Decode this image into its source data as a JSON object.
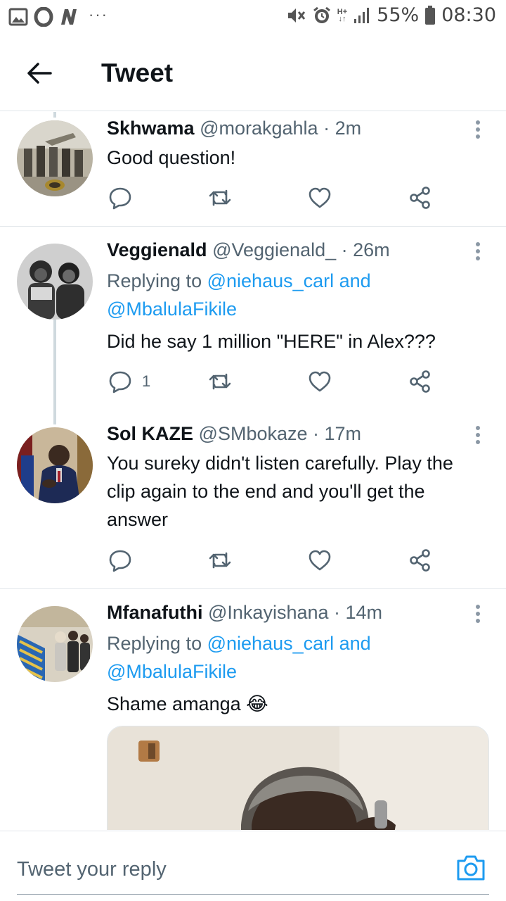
{
  "status_bar": {
    "battery": "55%",
    "time": "08:30",
    "network": "H+",
    "dots": "···",
    "icons": [
      "gallery-icon",
      "opera-icon",
      "news-icon",
      "mute-icon",
      "alarm-icon",
      "signal-icon",
      "battery-icon"
    ]
  },
  "header": {
    "title": "Tweet",
    "back_icon": "arrow-left-icon"
  },
  "tweets": [
    {
      "name": "Skhwama",
      "handle": "@morakgahla",
      "time": "· 2m",
      "text": "Good question!",
      "reply_count": "",
      "retweet_count": "",
      "like_count": ""
    },
    {
      "name": "Veggienald",
      "handle": "@Veggienald_",
      "time": "· 26m",
      "replying_prefix": "Replying to",
      "mention_1": "@niehaus_carl",
      "and": "and",
      "mention_2": "@MbalulaFikile",
      "text": "Did he say 1 million \"HERE\" in Alex???",
      "reply_count": "1",
      "retweet_count": "",
      "like_count": ""
    },
    {
      "name": "Sol KAZE",
      "handle": "@SMbokaze",
      "time": "· 17m",
      "text": "You sureky didn't listen carefully.  Play the clip again to the end and you'll get the answer",
      "reply_count": "",
      "retweet_count": "",
      "like_count": ""
    },
    {
      "name": "Mfanafuthi",
      "handle": "@Inkayishana",
      "time": "· 14m",
      "replying_prefix": "Replying to",
      "mention_1": "@niehaus_carl",
      "and": "and",
      "mention_2": "@MbalulaFikile",
      "text": "Shame amanga",
      "emoji": "😂"
    }
  ],
  "reply_bar": {
    "placeholder": "Tweet your reply",
    "camera_icon": "camera-icon"
  },
  "colors": {
    "accent": "#1d9bf0",
    "text": "#0f1419",
    "muted": "#536471",
    "divider": "#e1e6ea",
    "thread_line": "#cfd9de"
  }
}
